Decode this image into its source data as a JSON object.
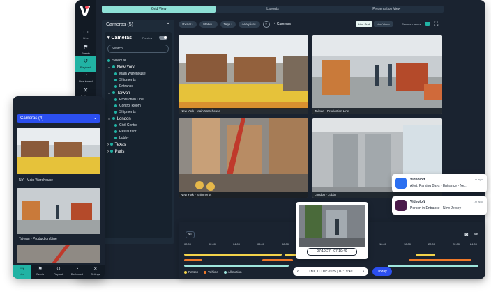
{
  "desktop": {
    "rail": [
      {
        "label": "Live",
        "icon": "camera-icon"
      },
      {
        "label": "Events",
        "icon": "events-icon"
      },
      {
        "label": "Playback",
        "icon": "playback-icon"
      },
      {
        "label": "Dashboard",
        "icon": "dashboard-icon"
      },
      {
        "label": "Settings",
        "icon": "settings-icon"
      }
    ],
    "view_tabs": [
      "Grid View",
      "Layouts",
      "Presentation View"
    ],
    "panel": {
      "header": "Cameras",
      "header_count": "(5)",
      "title": "Cameras",
      "preview_label": "Preview",
      "search_placeholder": "Search",
      "select_all": "Select all",
      "tree": {
        "new_york": {
          "label": "New York",
          "children": [
            "Main Warehouse",
            "Shipments",
            "Entrance"
          ]
        },
        "taiwan": {
          "label": "Taiwan",
          "children": [
            "Production Line",
            "Control Room",
            "Shipments"
          ]
        },
        "london": {
          "label": "London",
          "children": [
            "Civil Centre",
            "Restaurant",
            "Lobby"
          ]
        },
        "texas": {
          "label": "Texas"
        },
        "paris": {
          "label": "Paris"
        }
      }
    },
    "filters": [
      "Owner",
      "Status",
      "Tags",
      "Analytics"
    ],
    "camera_count": "4 Cameras",
    "live_tabs": [
      "Live Grid",
      "Live Video"
    ],
    "camera_names_label": "Camera names",
    "tiles": [
      {
        "caption": "New York - Main Warehouse"
      },
      {
        "caption": "Taiwan - Production Line"
      },
      {
        "caption": "New York - Shipments"
      },
      {
        "caption": "London - Lobby"
      }
    ],
    "timeline": {
      "speed": "x1",
      "ticks": [
        "00:00",
        "02:00",
        "04:00",
        "06:00",
        "08:00",
        "10:00",
        "12:00",
        "14:00",
        "16:00",
        "18:00",
        "20:00",
        "22:00",
        "24:00"
      ],
      "legend": [
        {
          "label": "Person",
          "color": "#f3d34a"
        },
        {
          "label": "Vehicle",
          "color": "#f07a2a"
        },
        {
          "label": "All motion",
          "color": "#9fe6dd"
        }
      ],
      "date": "Thu, 11 Dec 2025 | 07:19:49",
      "today": "Today"
    },
    "preview_time": "07:19:27 - 07:19:49"
  },
  "notifications": [
    {
      "app": "Videoloft",
      "message": "Alert: Parking Bays - Entrance - Ne...",
      "ago": "1m ago"
    },
    {
      "app": "Videoloft",
      "message": "Person in Entrance - New Jersey",
      "ago": "1m ago"
    }
  ],
  "mobile": {
    "dropdown": "Cameras (4)",
    "tiles": [
      {
        "caption": "NY - Main Warehouse"
      },
      {
        "caption": "Taiwan - Production Line"
      }
    ],
    "nav": [
      "Live",
      "Events",
      "Playback",
      "Dashboard",
      "Settings"
    ]
  },
  "colors": {
    "accent": "#21b3a4",
    "brand_blue": "#2b4ff0",
    "panel": "#1a2330"
  }
}
